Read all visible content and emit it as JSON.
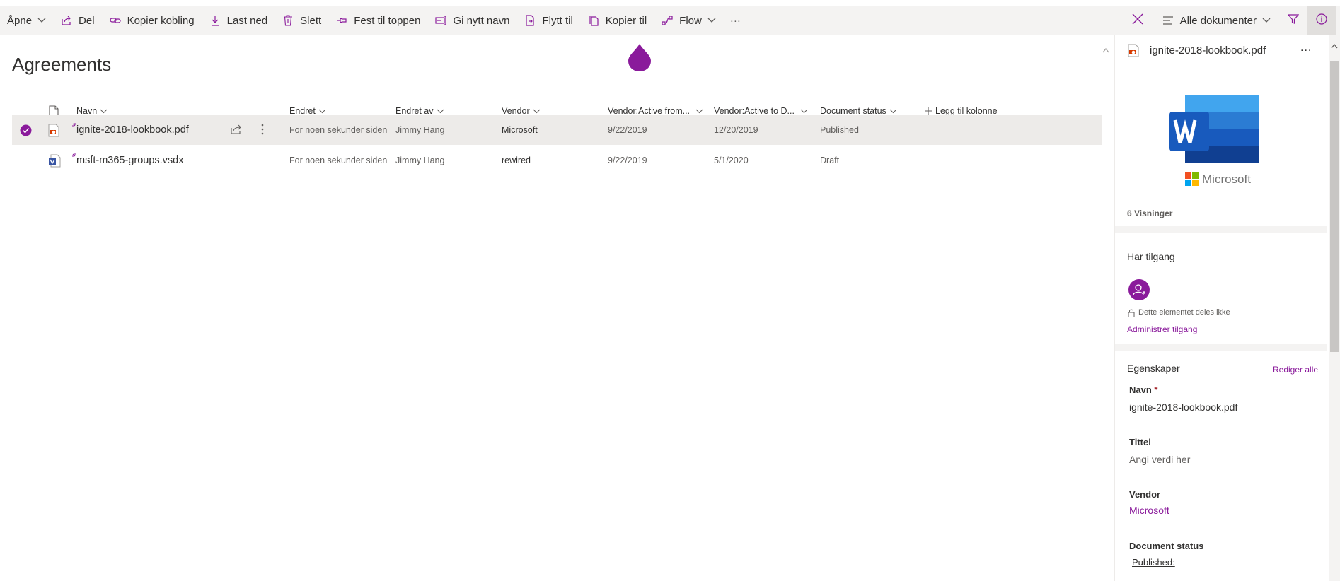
{
  "commandbar": {
    "open_label": "Åpne",
    "share_label": "Del",
    "copy_link_label": "Kopier kobling",
    "download_label": "Last ned",
    "delete_label": "Slett",
    "pin_label": "Fest til toppen",
    "rename_label": "Gi nytt navn",
    "move_label": "Flytt til",
    "copy_to_label": "Kopier til",
    "flow_label": "Flow",
    "more_label": "···",
    "view_label": "Alle dokumenter"
  },
  "library": {
    "title": "Agreements",
    "columns": {
      "name": "Navn",
      "modified": "Endret",
      "modified_by": "Endret av",
      "vendor": "Vendor",
      "active_from": "Vendor:Active from...",
      "active_to": "Vendor:Active to D...",
      "status": "Document status",
      "add_column": "Legg til kolonne"
    },
    "rows": [
      {
        "name": "ignite-2018-lookbook.pdf",
        "file_type": "pdf",
        "modified": "For noen sekunder siden",
        "modified_by": "Jimmy Hang",
        "vendor": "Microsoft",
        "active_from": "9/22/2019",
        "active_to": "12/20/2019",
        "status": "Published",
        "selected": true
      },
      {
        "name": "msft-m365-groups.vsdx",
        "file_type": "vsdx",
        "modified": "For noen sekunder siden",
        "modified_by": "Jimmy Hang",
        "vendor": "rewired",
        "active_from": "9/22/2019",
        "active_to": "5/1/2020",
        "status": "Draft",
        "selected": false
      }
    ]
  },
  "details_panel": {
    "file_name": "ignite-2018-lookbook.pdf",
    "more_label": "...",
    "logo_text": "Microsoft",
    "views": "6 Visninger",
    "access_heading": "Har tilgang",
    "not_shared": "Dette elementet deles ikke",
    "manage_access": "Administrer tilgang",
    "properties_heading": "Egenskaper",
    "edit_all": "Rediger alle",
    "props": {
      "name_label": "Navn",
      "required_mark": "*",
      "name_value": "ignite-2018-lookbook.pdf",
      "title_label": "Tittel",
      "title_placeholder": "Angi verdi her",
      "vendor_label": "Vendor",
      "vendor_value": "Microsoft",
      "status_label": "Document status",
      "status_value": "Published:"
    }
  },
  "colors": {
    "accent": "#8a1a9b",
    "commandbar_bg": "#f4f3f2",
    "selected_row": "#edebe9"
  }
}
